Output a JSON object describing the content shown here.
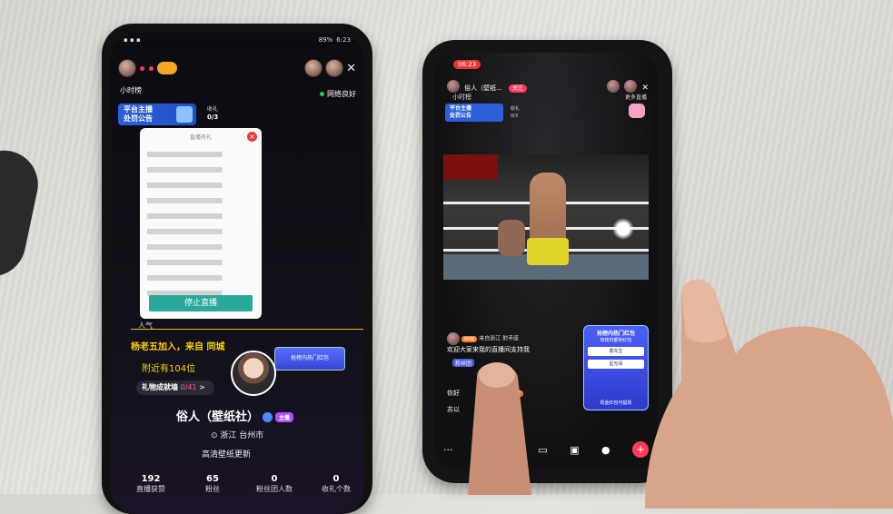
{
  "left_phone": {
    "status": {
      "time": "6:23",
      "battery": "89%"
    },
    "hour_rank": "小时榜",
    "network": "网络良好",
    "notice": {
      "line1": "平台主播",
      "line2": "处罚公告"
    },
    "earnings": {
      "label": "收礼",
      "value": "0/3"
    },
    "modal": {
      "title": "直播有礼",
      "close": "×",
      "stop_button": "停止直播"
    },
    "popularity": "人气",
    "join_message": "杨老五加入，来自 同城",
    "nearby_message": "附近有104位",
    "red_envelope_promo": "抢榜内热门红包",
    "gift_wall": {
      "label": "礼物成就墙",
      "progress": "0/41",
      "arrow": ">"
    },
    "profile": {
      "name": "俗人（壁纸社）",
      "tag": "主播",
      "location": "浙江 台州市",
      "description": "高清壁纸更新"
    },
    "stats": [
      {
        "value": "192",
        "label": "直播获赞"
      },
      {
        "value": "65",
        "label": "粉丝"
      },
      {
        "value": "0",
        "label": "粉丝团人数"
      },
      {
        "value": "0",
        "label": "收礼个数"
      }
    ]
  },
  "right_phone": {
    "time": "06:23",
    "streamer_name": "俗人（壁纸...",
    "follow_label": "关注",
    "hour_rank": "小时榜",
    "more_live": "更多直播",
    "notice": {
      "line1": "平台主播",
      "line2": "处罚公告"
    },
    "earnings": {
      "label": "收礼",
      "value": "0/3"
    },
    "fan_badge": "95级",
    "from_region": "来自浙江",
    "contact": "射手座",
    "welcome": "欢迎大家来我的直播间支持我",
    "chat_tag": "粉丝团",
    "chat_prefix_1": "你好",
    "chat_prefix_2": "苏以",
    "chat_suffix": "城",
    "level_tag": "打招呼",
    "red_envelope": {
      "title": "抢榜内热门红包",
      "subtitle": "热榜内都有红包",
      "row1": "霍先生",
      "row2": "星光哥",
      "bottom": "现金红包可提现"
    }
  }
}
